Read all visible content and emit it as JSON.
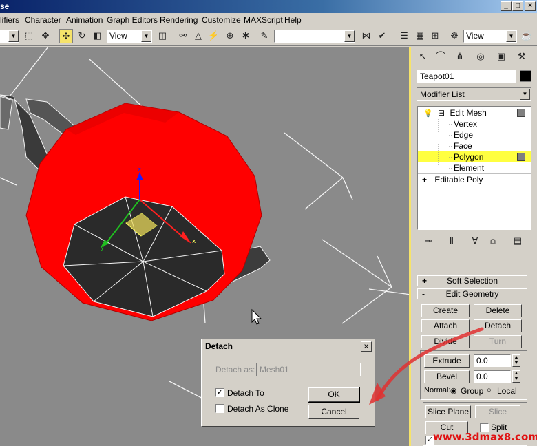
{
  "titlebar": {
    "title": "se"
  },
  "menu": [
    "lifiers",
    "Character",
    "Animation",
    "Graph Editors",
    "Rendering",
    "Customize",
    "MAXScript",
    "Help"
  ],
  "toolbar": {
    "ref_coord": "View",
    "named_selection": "",
    "view_combo": "View"
  },
  "cmd": {
    "object_name": "Teapot01",
    "object_color": "#000000",
    "modifier_list": "Modifier List",
    "stack": [
      {
        "label": "Edit Mesh",
        "sign": "⊟"
      },
      {
        "label": "Vertex"
      },
      {
        "label": "Edge"
      },
      {
        "label": "Face"
      },
      {
        "label": "Polygon",
        "selected": true
      },
      {
        "label": "Element"
      },
      {
        "label": "Editable Poly",
        "sign": "+"
      }
    ],
    "rollouts": {
      "soft_selection": "Soft Selection",
      "soft_sign": "+",
      "edit_geometry": "Edit Geometry",
      "edit_sign": "-"
    },
    "buttons": {
      "create": "Create",
      "delete": "Delete",
      "attach": "Attach",
      "detach": "Detach",
      "divide": "Divide",
      "turn": "Turn",
      "extrude": "Extrude",
      "extrude_val": "0.0",
      "bevel": "Bevel",
      "bevel_val": "0.0",
      "normal": "Normal:",
      "group": "Group",
      "local": "Local",
      "slice_plane": "Slice Plane",
      "slice": "Slice",
      "cut": "Cut",
      "split": "Split"
    }
  },
  "dialog": {
    "title": "Detach",
    "detach_as_label": "Detach as:",
    "detach_as_value": "Mesh01",
    "detach_to": "Detach To",
    "detach_to_checked": true,
    "detach_as_clone": "Detach As Clone",
    "ok": "OK",
    "cancel": "Cancel"
  },
  "watermark": "www.3dmax8.com",
  "colors": {
    "accent_yellow": "#f6e36a",
    "selection_red": "#ff0000",
    "annotation_red": "#e03030"
  }
}
